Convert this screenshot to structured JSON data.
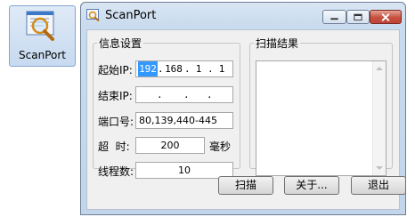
{
  "desktop": {
    "icon_label": "ScanPort",
    "icon_name": "scanport-app-icon"
  },
  "window": {
    "title": "ScanPort",
    "controls": {
      "minimize": "minimize-icon",
      "maximize": "maximize-icon",
      "close": "close-icon"
    }
  },
  "info_group": {
    "legend": "信息设置",
    "start_ip_label": "起始IP:",
    "start_ip": [
      "192",
      "168",
      "1",
      "1"
    ],
    "end_ip_label": "结束IP:",
    "end_ip": [
      "",
      "",
      "",
      ""
    ],
    "port_label": "端口号:",
    "port_value": "80,139,440-445",
    "timeout_label": "超  时:",
    "timeout_value": "200",
    "timeout_unit": "毫秒",
    "threads_label": "线程数:",
    "threads_value": "10"
  },
  "results_group": {
    "legend": "扫描结果"
  },
  "buttons": {
    "scan": "扫描",
    "about": "关于...",
    "exit": "退出"
  },
  "colors": {
    "selection": "#3399ff",
    "close_button": "#c6503d"
  }
}
